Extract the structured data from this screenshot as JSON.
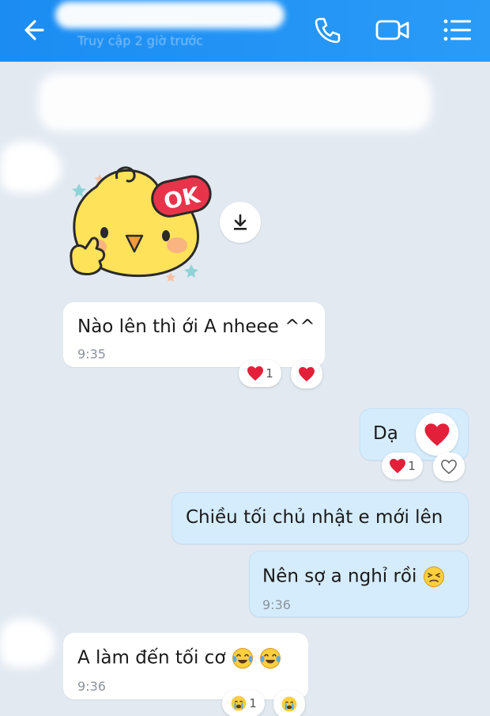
{
  "header": {
    "subtitle": "Truy cập 2 giờ trước",
    "icons": [
      "back-arrow-icon",
      "phone-icon",
      "video-call-icon",
      "menu-list-icon"
    ],
    "color": "#1b8cf2"
  },
  "sticker": {
    "text": "OK"
  },
  "messages": [
    {
      "text": "Nào lên thì ới A nheee ^^",
      "time": "9:35",
      "reaction_count": "1"
    },
    {
      "text": "Dạ",
      "reaction_count": "1"
    },
    {
      "text": "Chiều tối chủ nhật e mới lên"
    },
    {
      "text": "Nên sợ a nghỉ rồi",
      "time": "9:36"
    },
    {
      "text": "A làm đến tối cơ",
      "time": "9:36",
      "reaction_count": "1"
    }
  ]
}
